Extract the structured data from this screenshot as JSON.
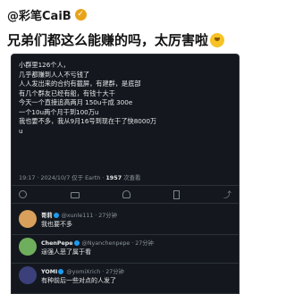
{
  "author": {
    "handle": "@彩笔CaiB",
    "badge": "✓"
  },
  "caption": "兄弟们都这么能赚的吗，太厉害啦",
  "screenshot": {
    "post_lines": [
      "小群里126个人，",
      "几乎都赚到人人不亏钱了",
      "人人发出来的合约有截屏，有建群，是底部",
      "有几个群友已经有船，有钱十大干",
      "今天一个直接追高两月 150u干成 300e",
      "一个10u两个月干到100万u",
      "我也要不多，我从9月16号到现在干了快8000万",
      "u"
    ],
    "meta": {
      "time": "19:17 · 2024/10/7 仅于 Earth · ",
      "views": "1957",
      "views_label": " 次查看"
    },
    "replies": [
      {
        "name": "哥莉",
        "badge": true,
        "handle": "@xunle111 · 27分钟",
        "text": "我也要不多",
        "avatar": "#d9a05b"
      },
      {
        "name": "ChenPepe",
        "badge": true,
        "handle": "@Nyanchenpepe · 27分钟",
        "text": "逞强人恶了属于看",
        "avatar": "#6fae5c"
      },
      {
        "name": "YOMI",
        "badge": true,
        "handle": "@yomiXrich · 27分钟",
        "text": "有种前后一些对点的人发了",
        "avatar": "#3b3f7a"
      }
    ]
  }
}
